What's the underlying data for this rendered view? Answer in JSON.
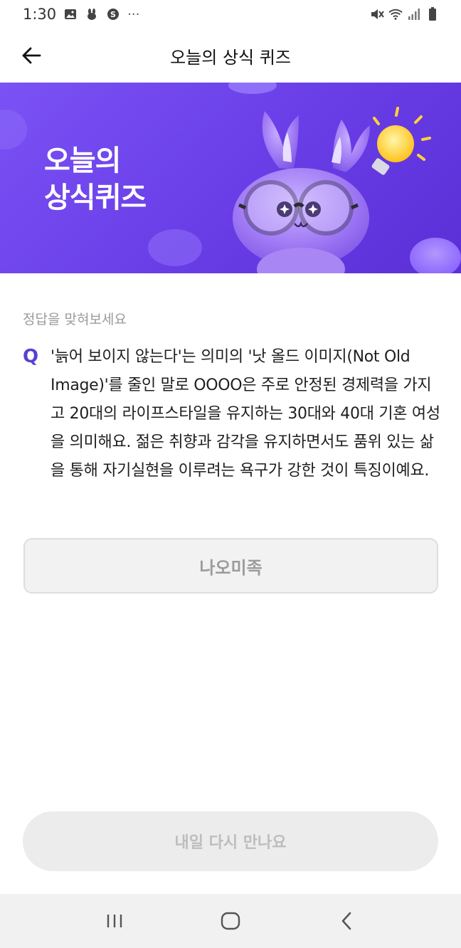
{
  "status_bar": {
    "time": "1:30",
    "more": "···"
  },
  "header": {
    "title": "오늘의 상식 퀴즈"
  },
  "banner": {
    "title_line1": "오늘의",
    "title_line2": "상식퀴즈"
  },
  "quiz": {
    "hint": "정답을 맞혀보세요",
    "q_mark": "Q",
    "question": "'늙어 보이지 않는다'는 의미의 '낫 올드 이미지(Not Old Image)'를 줄인 말로 OOOO은 주로 안정된 경제력을 가지고 20대의 라이프스타일을 유지하는 30대와 40대 기혼 여성을 의미해요. 젊은 취향과 감각을 유지하면서도 품위 있는 삶을 통해 자기실현을 이루려는 욕구가 강한 것이 특징이예요.",
    "answer": "나오미족"
  },
  "cta": {
    "label": "내일 다시 만나요"
  },
  "colors": {
    "banner": "#6a3fe8",
    "accent": "#5b3fd0"
  }
}
